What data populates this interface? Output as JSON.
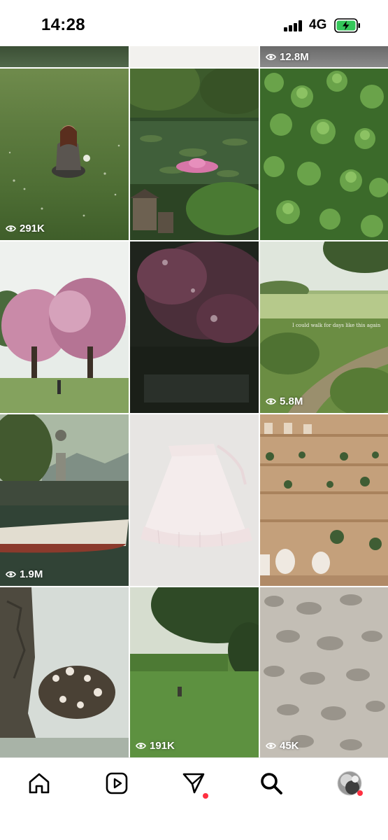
{
  "status_bar": {
    "time": "14:28",
    "network": "4G",
    "battery_charging": true,
    "battery_color": "#34c759"
  },
  "grid": {
    "row0_partial": [
      {
        "name": "top-tile-1",
        "views": ""
      },
      {
        "name": "top-tile-2",
        "views": ""
      },
      {
        "name": "top-tile-3",
        "views": "12.8M"
      }
    ],
    "row1": [
      {
        "name": "woman-in-meadow",
        "views": "291K"
      },
      {
        "name": "lily-pond-house",
        "views": ""
      },
      {
        "name": "clover-field",
        "views": ""
      }
    ],
    "row2": [
      {
        "name": "blossom-trees",
        "views": ""
      },
      {
        "name": "dark-blossoms",
        "views": ""
      },
      {
        "name": "countryside-path",
        "views": "5.8M",
        "caption": "I could walk for days like this again"
      }
    ],
    "row3": [
      {
        "name": "lake-boat-statue",
        "views": "1.9M"
      },
      {
        "name": "white-skirt",
        "views": ""
      },
      {
        "name": "plant-shelves",
        "views": ""
      }
    ],
    "row4": [
      {
        "name": "misty-cliff-tree",
        "views": ""
      },
      {
        "name": "green-field-figure",
        "views": "191K"
      },
      {
        "name": "stone-texture",
        "views": "45K"
      }
    ]
  },
  "tab_bar": {
    "items": [
      "home-icon",
      "reels-icon",
      "messages-icon",
      "search-icon",
      "profile-avatar"
    ],
    "active": "search-icon",
    "notification_color": "#ff3040"
  }
}
